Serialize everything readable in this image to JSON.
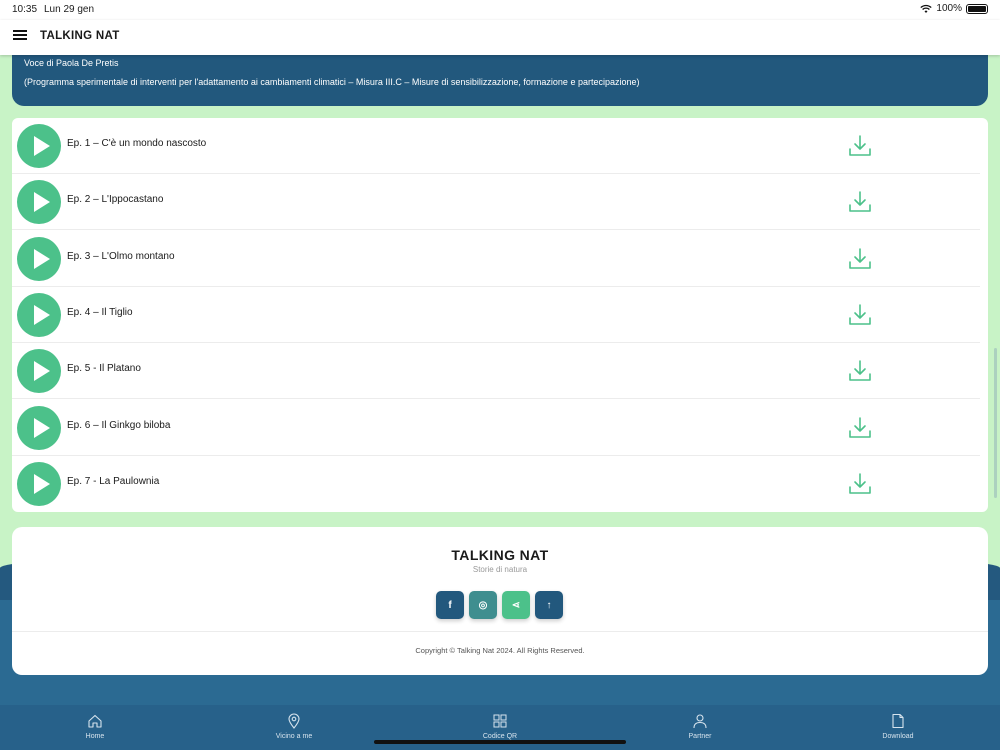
{
  "status_bar": {
    "time": "10:35",
    "date": "Lun 29 gen",
    "battery": "100%"
  },
  "header": {
    "title": "TALKING NAT",
    "menu_icon": "hamburger-icon"
  },
  "info": {
    "voice": "Voce di Paola De Pretis",
    "program": "(Programma sperimentale di interventi per l'adattamento ai cambiamenti climatici – Misura III.C – Misure di sensibilizzazione, formazione e partecipazione)"
  },
  "episodes": [
    {
      "title": "Ep. 1 – C'è un mondo nascosto"
    },
    {
      "title": "Ep. 2 – L'Ippocastano"
    },
    {
      "title": "Ep. 3 – L'Olmo montano"
    },
    {
      "title": "Ep. 4 – Il Tiglio"
    },
    {
      "title": "Ep. 5 - Il Platano"
    },
    {
      "title": "Ep. 6 – Il Ginkgo biloba"
    },
    {
      "title": "Ep. 7 - La Paulownia"
    }
  ],
  "footer": {
    "brand": "TALKING NAT",
    "tagline": "Storie di natura",
    "social": [
      {
        "icon": "facebook-icon",
        "glyph": "f",
        "color": "#22587d"
      },
      {
        "icon": "instagram-icon",
        "glyph": "◎",
        "color": "#3f8e8f"
      },
      {
        "icon": "share-icon",
        "glyph": "⋖",
        "color": "#4cc18a"
      },
      {
        "icon": "arrow-up-icon",
        "glyph": "↑",
        "color": "#22587d"
      }
    ],
    "copyright": "Copyright © Talking Nat 2024. All Rights Reserved."
  },
  "tabs": [
    {
      "label": "Home",
      "icon": "home-icon"
    },
    {
      "label": "Vicino a me",
      "icon": "location-pin-icon"
    },
    {
      "label": "Codice QR",
      "icon": "qr-grid-icon"
    },
    {
      "label": "Partner",
      "icon": "person-icon"
    },
    {
      "label": "Download",
      "icon": "document-icon"
    }
  ],
  "colors": {
    "accent": "#4cc18a",
    "primary": "#22587d",
    "background": "#c8f3c6"
  }
}
